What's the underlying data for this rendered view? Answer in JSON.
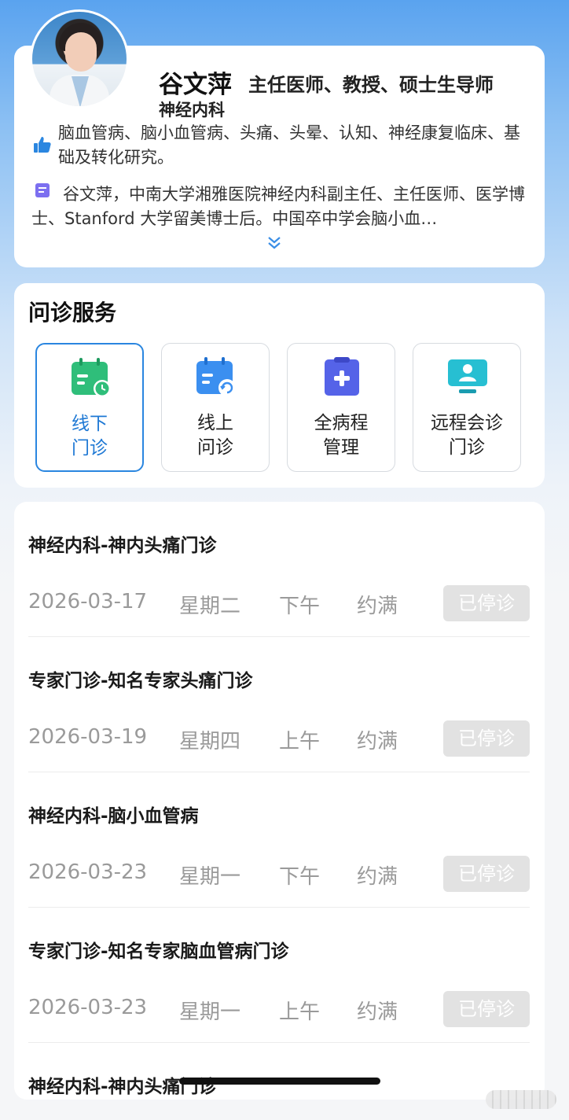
{
  "doctor": {
    "name": "谷文萍",
    "title": "主任医师、教授、硕士生导师",
    "department": "神经内科",
    "expertise": "脑血管病、脑小血管病、头痛、头晕、认知、神经康复临床、基础及转化研究。",
    "intro": "谷文萍，中南大学湘雅医院神经内科副主任、主任医师、医学博士、Stanford 大学留美博士后。中国卒中学会脑小血…"
  },
  "services": {
    "heading": "问诊服务",
    "items": [
      {
        "label": "线下\n门诊",
        "icon": "calendar-clock-icon",
        "active": true
      },
      {
        "label": "线上\n问诊",
        "icon": "calendar-refresh-icon",
        "active": false
      },
      {
        "label": "全病程\n管理",
        "icon": "clipboard-plus-icon",
        "active": false
      },
      {
        "label": "远程会诊\n门诊",
        "icon": "monitor-user-icon",
        "active": false
      }
    ]
  },
  "schedule": [
    {
      "title": "神经内科-神内头痛门诊",
      "date": "2026-03-17",
      "weekday": "星期二",
      "period": "下午",
      "status": "约满",
      "button": "已停诊"
    },
    {
      "title": "专家门诊-知名专家头痛门诊",
      "date": "2026-03-19",
      "weekday": "星期四",
      "period": "上午",
      "status": "约满",
      "button": "已停诊"
    },
    {
      "title": "神经内科-脑小血管病",
      "date": "2026-03-23",
      "weekday": "星期一",
      "period": "下午",
      "status": "约满",
      "button": "已停诊"
    },
    {
      "title": "专家门诊-知名专家脑血管病门诊",
      "date": "2026-03-23",
      "weekday": "星期一",
      "period": "上午",
      "status": "约满",
      "button": "已停诊"
    },
    {
      "title": "神经内科-神内头痛门诊"
    }
  ],
  "colors": {
    "accent": "#1e78d4",
    "disabled": "#e2e2e2",
    "muted_text": "#9a9a9a"
  }
}
